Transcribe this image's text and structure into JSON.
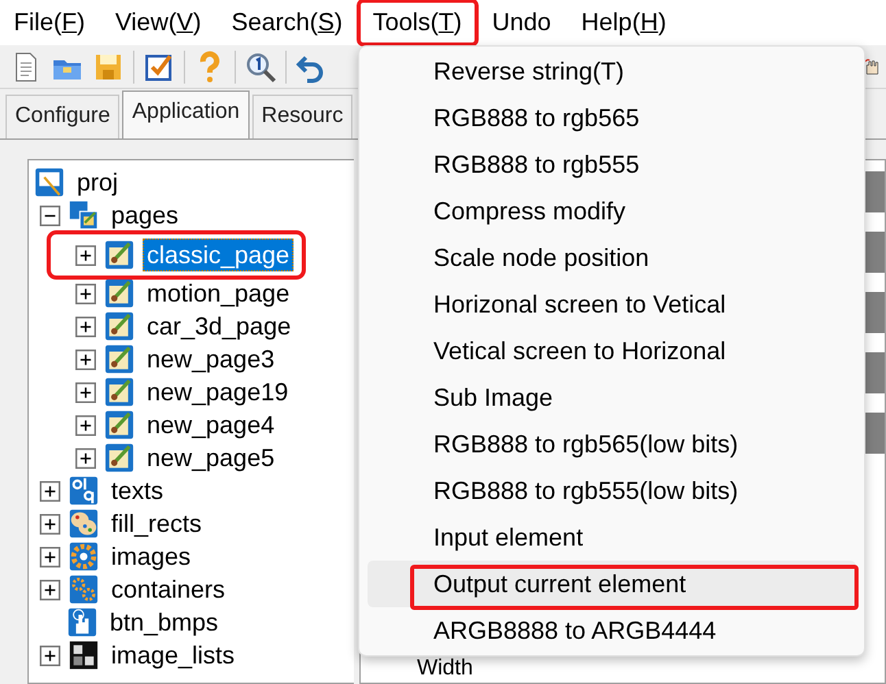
{
  "menu_bar": [
    {
      "parts": [
        "File(",
        "F",
        ")"
      ],
      "annotated": false
    },
    {
      "parts": [
        "View(",
        "V",
        ")"
      ],
      "annotated": false
    },
    {
      "parts": [
        "Search(",
        "S",
        ")"
      ],
      "annotated": false
    },
    {
      "parts": [
        "Tools(",
        "T",
        ")"
      ],
      "annotated": true
    },
    {
      "parts": [
        "Undo"
      ],
      "annotated": false
    },
    {
      "parts": [
        "Help(",
        "H",
        ")"
      ],
      "annotated": false
    }
  ],
  "toolbar": [
    {
      "kind": "new"
    },
    {
      "kind": "open"
    },
    {
      "kind": "save"
    },
    {
      "kind": "sep"
    },
    {
      "kind": "check"
    },
    {
      "kind": "sep"
    },
    {
      "kind": "help"
    },
    {
      "kind": "sep"
    },
    {
      "kind": "find"
    },
    {
      "kind": "sep"
    },
    {
      "kind": "undo"
    }
  ],
  "tabs": [
    {
      "label": "Configure",
      "selected": false
    },
    {
      "label": "Application",
      "selected": true
    },
    {
      "label": "Resourc",
      "selected": false
    }
  ],
  "tree": [
    {
      "label": "proj",
      "kind": "project",
      "selected": false,
      "annotated": false,
      "children": [
        {
          "label": "pages",
          "kind": "pages",
          "expandable": true,
          "expanded": true,
          "selected": false,
          "annotated": false,
          "children": [
            {
              "label": "classic_page",
              "kind": "page",
              "expandable": true,
              "expanded": false,
              "selected": true,
              "annotated": true
            },
            {
              "label": "motion_page",
              "kind": "page",
              "expandable": true,
              "expanded": false,
              "selected": false,
              "annotated": false
            },
            {
              "label": "car_3d_page",
              "kind": "page",
              "expandable": true,
              "expanded": false,
              "selected": false,
              "annotated": false
            },
            {
              "label": "new_page3",
              "kind": "page",
              "expandable": true,
              "expanded": false,
              "selected": false,
              "annotated": false
            },
            {
              "label": "new_page19",
              "kind": "page",
              "expandable": true,
              "expanded": false,
              "selected": false,
              "annotated": false
            },
            {
              "label": "new_page4",
              "kind": "page",
              "expandable": true,
              "expanded": false,
              "selected": false,
              "annotated": false
            },
            {
              "label": "new_page5",
              "kind": "page",
              "expandable": true,
              "expanded": false,
              "selected": false,
              "annotated": false
            }
          ]
        },
        {
          "label": "texts",
          "kind": "texts",
          "expandable": true,
          "expanded": false,
          "selected": false,
          "annotated": false
        },
        {
          "label": "fill_rects",
          "kind": "palette",
          "expandable": true,
          "expanded": false,
          "selected": false,
          "annotated": false
        },
        {
          "label": "images",
          "kind": "gear",
          "expandable": true,
          "expanded": false,
          "selected": false,
          "annotated": false
        },
        {
          "label": "containers",
          "kind": "gears",
          "expandable": true,
          "expanded": false,
          "selected": false,
          "annotated": false
        },
        {
          "label": "btn_bmps",
          "kind": "hand",
          "expandable": false,
          "expanded": false,
          "selected": false,
          "annotated": false
        },
        {
          "label": "image_lists",
          "kind": "film",
          "expandable": true,
          "expanded": false,
          "selected": false,
          "annotated": false
        }
      ]
    }
  ],
  "property_grid": {
    "label": "Width"
  },
  "tools_menu": {
    "items": [
      {
        "label": "Reverse string(T)",
        "hovered": false,
        "annotated": false
      },
      {
        "label": "RGB888 to rgb565",
        "hovered": false,
        "annotated": false
      },
      {
        "label": "RGB888 to rgb555",
        "hovered": false,
        "annotated": false
      },
      {
        "label": "Compress modify",
        "hovered": false,
        "annotated": false
      },
      {
        "label": "Scale node position",
        "hovered": false,
        "annotated": false
      },
      {
        "label": "Horizonal screen to Vetical",
        "hovered": false,
        "annotated": false
      },
      {
        "label": "Vetical screen to Horizonal",
        "hovered": false,
        "annotated": false
      },
      {
        "label": "Sub Image",
        "hovered": false,
        "annotated": false
      },
      {
        "label": "RGB888 to rgb565(low bits)",
        "hovered": false,
        "annotated": false
      },
      {
        "label": "RGB888 to rgb555(low bits)",
        "hovered": false,
        "annotated": false
      },
      {
        "label": "Input element",
        "hovered": false,
        "annotated": false
      },
      {
        "label": "Output current element",
        "hovered": true,
        "annotated": true
      },
      {
        "label": "ARGB8888 to ARGB4444",
        "hovered": false,
        "annotated": false
      }
    ]
  }
}
